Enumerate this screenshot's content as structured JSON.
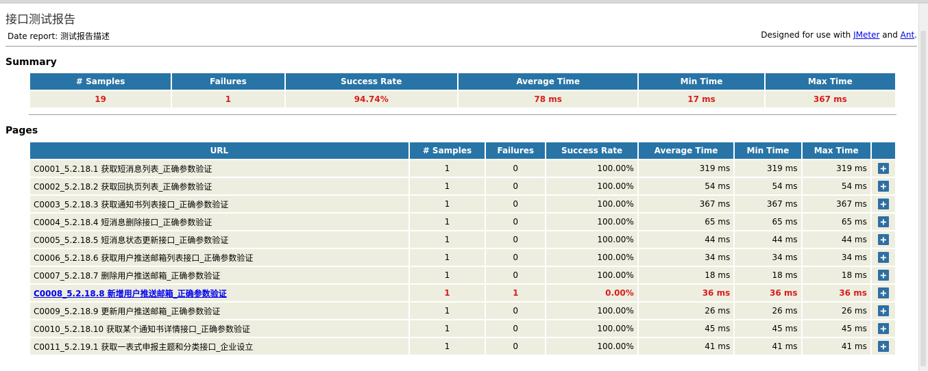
{
  "page": {
    "title": "接口测试报告",
    "date_report_label": "Date report:",
    "date_report_value": "测试报告描述",
    "designed_prefix": "Designed for use with",
    "designed_link1": "JMeter",
    "designed_and": "and",
    "designed_link2": "Ant",
    "designed_suffix": "."
  },
  "summary": {
    "heading": "Summary",
    "headers": [
      "# Samples",
      "Failures",
      "Success Rate",
      "Average Time",
      "Min Time",
      "Max Time"
    ],
    "values": [
      "19",
      "1",
      "94.74%",
      "78 ms",
      "17 ms",
      "367 ms"
    ]
  },
  "pages": {
    "heading": "Pages",
    "headers": [
      "URL",
      "# Samples",
      "Failures",
      "Success Rate",
      "Average Time",
      "Min Time",
      "Max Time",
      ""
    ],
    "expand_symbol": "+",
    "rows": [
      {
        "url": "C0001_5.2.18.1 获取短消息列表_正确参数验证",
        "samples": "1",
        "failures": "0",
        "rate": "100.00%",
        "avg": "319 ms",
        "min": "319 ms",
        "max": "319 ms",
        "failed": false
      },
      {
        "url": "C0002_5.2.18.2 获取回执页列表_正确参数验证",
        "samples": "1",
        "failures": "0",
        "rate": "100.00%",
        "avg": "54 ms",
        "min": "54 ms",
        "max": "54 ms",
        "failed": false
      },
      {
        "url": "C0003_5.2.18.3 获取通知书列表接口_正确参数验证",
        "samples": "1",
        "failures": "0",
        "rate": "100.00%",
        "avg": "367 ms",
        "min": "367 ms",
        "max": "367 ms",
        "failed": false
      },
      {
        "url": "C0004_5.2.18.4 短消息删除接口_正确参数验证",
        "samples": "1",
        "failures": "0",
        "rate": "100.00%",
        "avg": "65 ms",
        "min": "65 ms",
        "max": "65 ms",
        "failed": false
      },
      {
        "url": "C0005_5.2.18.5 短消息状态更新接口_正确参数验证",
        "samples": "1",
        "failures": "0",
        "rate": "100.00%",
        "avg": "44 ms",
        "min": "44 ms",
        "max": "44 ms",
        "failed": false
      },
      {
        "url": "C0006_5.2.18.6 获取用户推送邮箱列表接口_正确参数验证",
        "samples": "1",
        "failures": "0",
        "rate": "100.00%",
        "avg": "34 ms",
        "min": "34 ms",
        "max": "34 ms",
        "failed": false
      },
      {
        "url": "C0007_5.2.18.7 删除用户推送邮箱_正确参数验证",
        "samples": "1",
        "failures": "0",
        "rate": "100.00%",
        "avg": "18 ms",
        "min": "18 ms",
        "max": "18 ms",
        "failed": false
      },
      {
        "url": "C0008_5.2.18.8 新增用户推送邮箱_正确参数验证",
        "samples": "1",
        "failures": "1",
        "rate": "0.00%",
        "avg": "36 ms",
        "min": "36 ms",
        "max": "36 ms",
        "failed": true
      },
      {
        "url": "C0009_5.2.18.9 更新用户推送邮箱_正确参数验证",
        "samples": "1",
        "failures": "0",
        "rate": "100.00%",
        "avg": "26 ms",
        "min": "26 ms",
        "max": "26 ms",
        "failed": false
      },
      {
        "url": "C0010_5.2.18.10 获取某个通知书详情接口_正确参数验证",
        "samples": "1",
        "failures": "0",
        "rate": "100.00%",
        "avg": "45 ms",
        "min": "45 ms",
        "max": "45 ms",
        "failed": false
      },
      {
        "url": "C0011_5.2.19.1 获取一表式申报主题和分类接口_企业设立",
        "samples": "1",
        "failures": "0",
        "rate": "100.00%",
        "avg": "41 ms",
        "min": "41 ms",
        "max": "41 ms",
        "failed": false
      }
    ]
  },
  "colors": {
    "header_bg": "#2874a6",
    "cell_bg": "#eeeee0",
    "failure_red": "#d81e1e",
    "link_blue": "#0000ee"
  }
}
